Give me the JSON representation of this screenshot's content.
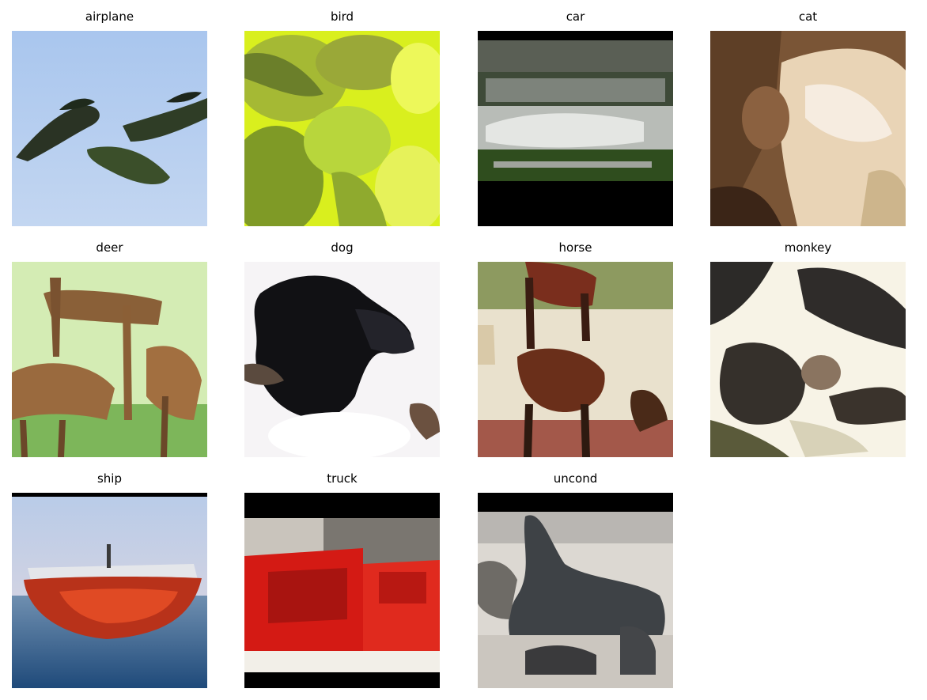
{
  "grid": {
    "panels": [
      {
        "title": "airplane"
      },
      {
        "title": "bird"
      },
      {
        "title": "car"
      },
      {
        "title": "cat"
      },
      {
        "title": "deer"
      },
      {
        "title": "dog"
      },
      {
        "title": "horse"
      },
      {
        "title": "monkey"
      },
      {
        "title": "ship"
      },
      {
        "title": "truck"
      },
      {
        "title": "uncond"
      }
    ]
  }
}
